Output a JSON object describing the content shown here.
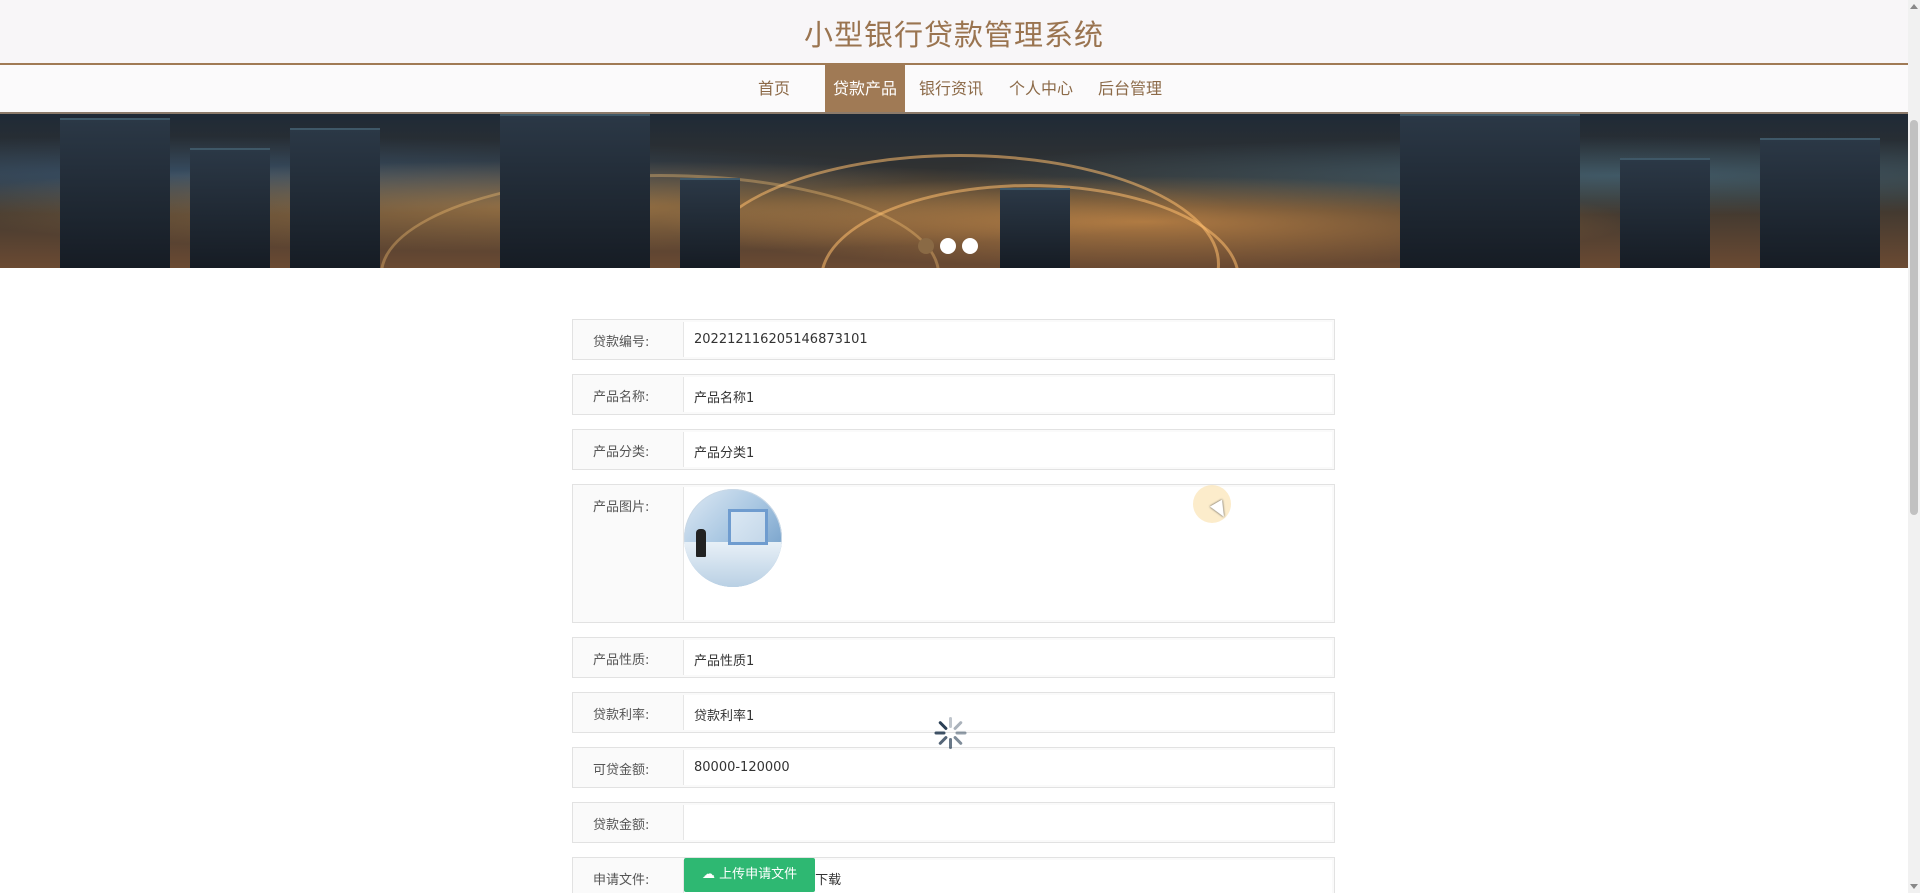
{
  "header": {
    "title": "小型银行贷款管理系统"
  },
  "nav": {
    "items": [
      {
        "label": "首页",
        "active": false
      },
      {
        "label": "贷款产品",
        "active": true
      },
      {
        "label": "银行资讯",
        "active": false
      },
      {
        "label": "个人中心",
        "active": false
      },
      {
        "label": "后台管理",
        "active": false
      }
    ]
  },
  "banner": {
    "dots": 3,
    "current_dot": 1
  },
  "form": {
    "loan_no": {
      "label": "贷款编号:",
      "value": "202212116205146873101"
    },
    "product_name": {
      "label": "产品名称:",
      "value": "产品名称1"
    },
    "product_category": {
      "label": "产品分类:",
      "value": "产品分类1"
    },
    "product_image": {
      "label": "产品图片:"
    },
    "product_nature": {
      "label": "产品性质:",
      "value": "产品性质1"
    },
    "loan_rate": {
      "label": "贷款利率:",
      "value": "贷款利率1"
    },
    "loan_amount_range": {
      "label": "可贷金额:",
      "value": "80000-120000"
    },
    "loan_amount": {
      "label": "贷款金额:",
      "value": ""
    },
    "application_file": {
      "label": "申请文件:",
      "upload_label": "上传申请文件",
      "download_label": "下载"
    }
  },
  "colors": {
    "brand": "#a07a55",
    "upload": "#2eb872"
  },
  "icons": {
    "upload": "cloud-upload-icon",
    "spinner": "loading-spinner-icon"
  }
}
